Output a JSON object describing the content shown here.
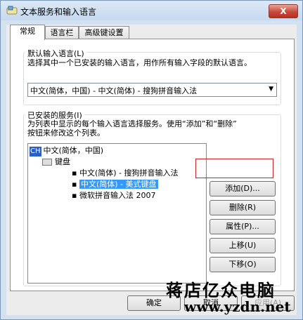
{
  "window": {
    "title": "文本服务和输入语言",
    "close_label": "X"
  },
  "tabs": [
    {
      "label": "常规",
      "active": true
    },
    {
      "label": "语言栏",
      "active": false
    },
    {
      "label": "高级键设置",
      "active": false
    }
  ],
  "default_language": {
    "group_label": "默认输入语言(L)",
    "description": "选择其中一个已安装的输入语言，用作所有输入字段的默认语言。",
    "selected": "中文(简体，中国) - 中文(简体) - 搜狗拼音输入法"
  },
  "installed_services": {
    "group_label": "已安装的服务(I)",
    "description_line1": "为列表中显示的每个输入语言选择服务。使用“添加”和“删除”",
    "description_line2": "按钮来修改这个列表。",
    "tree": {
      "language": {
        "badge": "CH",
        "label": "中文(简体，中国)"
      },
      "category": "键盘",
      "items": [
        {
          "label": "中文(简体) - 搜狗拼音输入法",
          "selected": false
        },
        {
          "label": "中文(简体) - 美式键盘",
          "selected": true
        },
        {
          "label": "微软拼音输入法 2007",
          "selected": false
        }
      ]
    }
  },
  "buttons": {
    "add": "添加(D)...",
    "remove": "删除(R)",
    "properties": "属性(P)...",
    "move_up": "上移(U)",
    "move_down": "下移(O)",
    "ok": "确定",
    "cancel": "取消",
    "apply": "应用(A)"
  },
  "watermark": {
    "text": "蒋店亿众电脑",
    "url": "www.yzdn.net"
  },
  "colors": {
    "selection": "#3399ff",
    "highlight_box": "#cc2222"
  }
}
